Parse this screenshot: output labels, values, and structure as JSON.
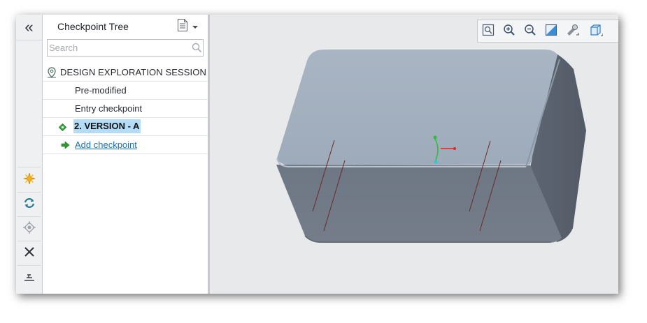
{
  "left_toolbar": {
    "collapse_label": "«",
    "icons": [
      "star-icon",
      "refresh-icon",
      "locate-icon",
      "delete-icon",
      "filter-icon"
    ]
  },
  "panel": {
    "title": "Checkpoint Tree",
    "search": {
      "placeholder": "Search",
      "value": ""
    },
    "tree": {
      "session": "DESIGN EXPLORATION SESSION",
      "items": [
        "Pre-modified",
        "Entry checkpoint",
        "2. VERSION - A"
      ],
      "add_label": "Add checkpoint"
    }
  },
  "view_toolbar": {
    "icons": [
      "refit-icon",
      "zoom-in-icon",
      "zoom-out-icon",
      "repaint-icon",
      "perspective-icon",
      "saved-views-icon"
    ]
  },
  "colors": {
    "selection": "#b4dcf6",
    "link": "#1a6eb5",
    "model_top": "#a7b3c1",
    "model_front": "#6e7783",
    "model_side": "#5b6370"
  }
}
